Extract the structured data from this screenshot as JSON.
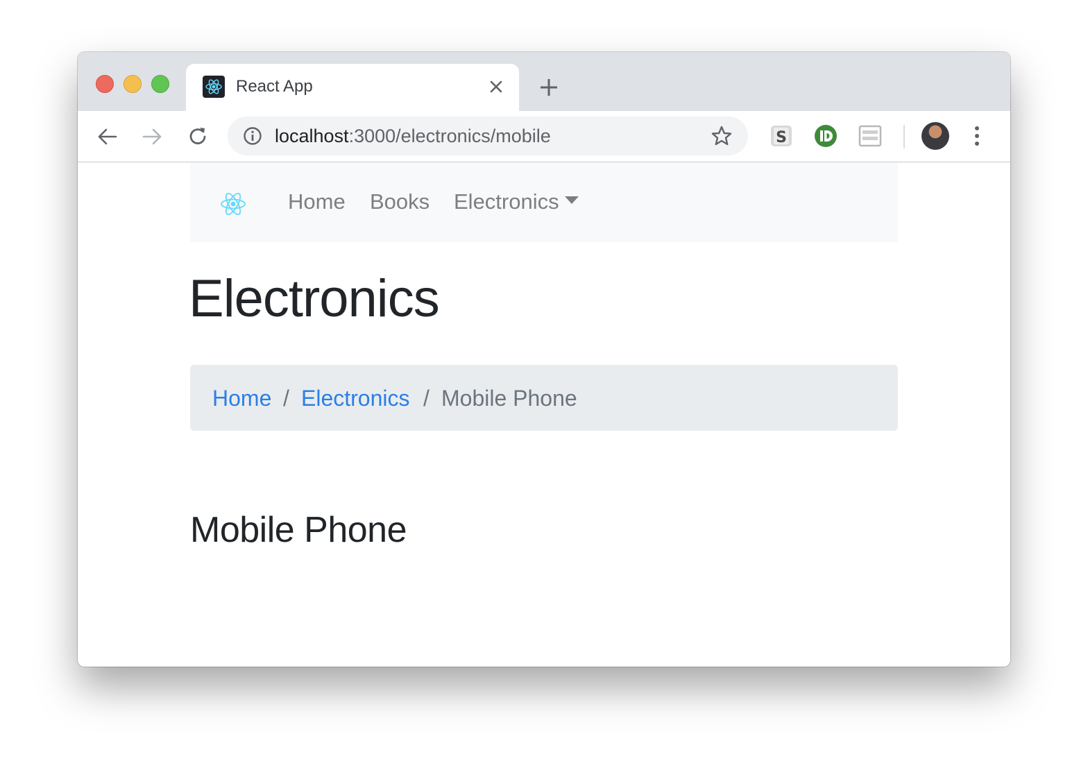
{
  "browser": {
    "tab": {
      "title": "React App",
      "favicon": "react-logo"
    },
    "address": {
      "host": "localhost",
      "path": ":3000/electronics/mobile"
    },
    "extensions": [
      "s-extension-icon",
      "id-extension-icon",
      "reader-extension-icon"
    ],
    "colors": {
      "tabstrip": "#dee1e6",
      "omnibox": "#f1f3f4"
    }
  },
  "navbar": {
    "brand_icon": "react-logo-icon",
    "links": [
      {
        "label": "Home"
      },
      {
        "label": "Books"
      },
      {
        "label": "Electronics"
      }
    ],
    "background": "#f8f9fa",
    "link_color": "#7b7f83"
  },
  "page": {
    "title": "Electronics",
    "breadcrumb": {
      "items": [
        {
          "label": "Home",
          "active": false
        },
        {
          "label": "Electronics",
          "active": false
        },
        {
          "label": "Mobile Phone",
          "active": true
        }
      ],
      "separator": "/",
      "link_color": "#2b7fe6",
      "background": "#e9ecef"
    },
    "section_title": "Mobile Phone"
  }
}
